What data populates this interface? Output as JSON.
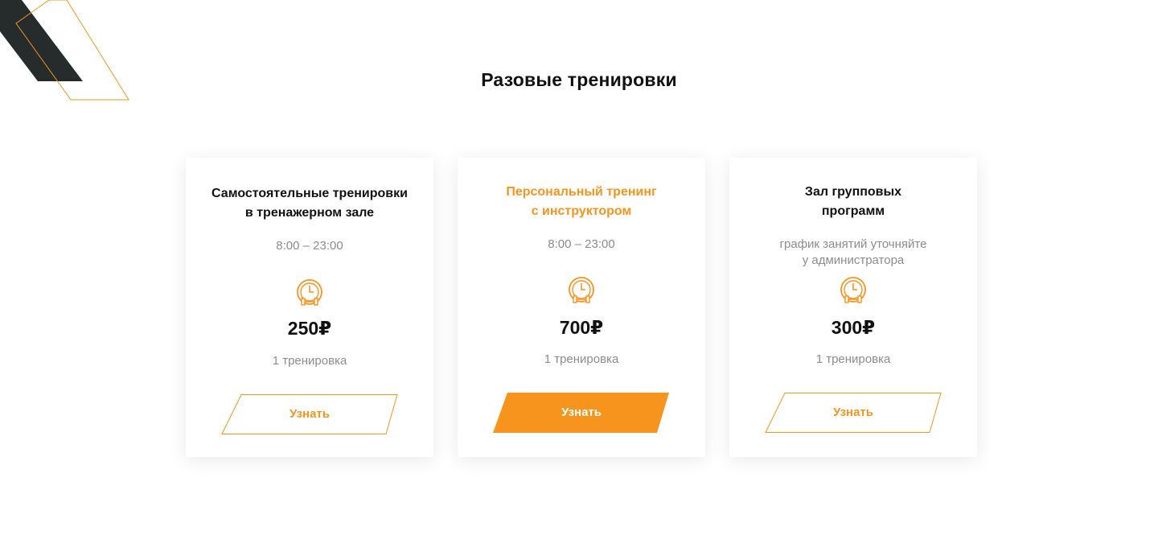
{
  "section": {
    "title": "Разовые тренировки"
  },
  "accent_color": "#f7941d",
  "decor_dark_color": "#262b2c",
  "cards": [
    {
      "title": "Самостоятельные тренировки\nв тренажерном зале",
      "schedule": "8:00 – 23:00",
      "icon": "clock-dumbbell-icon",
      "price": "250₽",
      "unit": "1 тренировка",
      "button_label": "Узнать",
      "highlighted": false
    },
    {
      "title": "Персональный тренинг\nс инструктором",
      "schedule": "8:00 – 23:00",
      "icon": "clock-dumbbell-icon",
      "price": "700₽",
      "unit": "1 тренировка",
      "button_label": "Узнать",
      "highlighted": true
    },
    {
      "title": "Зал групповых\nпрограмм",
      "schedule": "график занятий уточняйте\nу администратора",
      "icon": "clock-dumbbell-icon",
      "price": "300₽",
      "unit": "1 тренировка",
      "button_label": "Узнать",
      "highlighted": false
    }
  ]
}
